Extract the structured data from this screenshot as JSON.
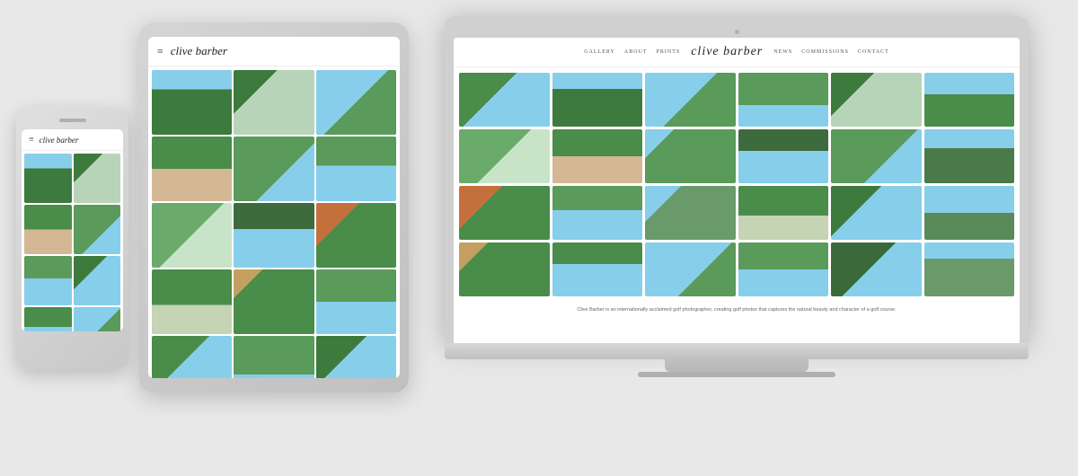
{
  "scene": {
    "background_color": "#e8e8e8"
  },
  "laptop": {
    "website": {
      "nav": {
        "logo": "clive barber",
        "left_links": [
          "GALLERY",
          "ABOUT",
          "PRINTS"
        ],
        "right_links": [
          "NEWS",
          "COMMISSIONS",
          "CONTACT"
        ]
      },
      "gallery": {
        "photo_count": 24,
        "photos": [
          {
            "id": 1,
            "class": "gp1"
          },
          {
            "id": 2,
            "class": "gp2"
          },
          {
            "id": 3,
            "class": "gp3"
          },
          {
            "id": 4,
            "class": "gp4"
          },
          {
            "id": 5,
            "class": "gp5"
          },
          {
            "id": 6,
            "class": "gp6"
          },
          {
            "id": 7,
            "class": "gp7"
          },
          {
            "id": 8,
            "class": "gp8"
          },
          {
            "id": 9,
            "class": "gp9"
          },
          {
            "id": 10,
            "class": "gp10"
          },
          {
            "id": 11,
            "class": "gp11"
          },
          {
            "id": 12,
            "class": "gp12"
          },
          {
            "id": 13,
            "class": "gp13"
          },
          {
            "id": 14,
            "class": "gp14"
          },
          {
            "id": 15,
            "class": "gp15"
          },
          {
            "id": 16,
            "class": "gp16"
          },
          {
            "id": 17,
            "class": "gp17"
          },
          {
            "id": 18,
            "class": "gp18"
          },
          {
            "id": 19,
            "class": "gp19"
          },
          {
            "id": 20,
            "class": "gp20"
          },
          {
            "id": 21,
            "class": "gp21"
          },
          {
            "id": 22,
            "class": "gp22"
          },
          {
            "id": 23,
            "class": "gp23"
          },
          {
            "id": 24,
            "class": "gp24"
          }
        ]
      },
      "footer_text": "Clive Barber is an internationally acclaimed golf photographer, creating golf photos that captures the natural beauty and character of a golf course."
    }
  },
  "tablet": {
    "nav": {
      "logo": "clive barber",
      "hamburger": "≡"
    }
  },
  "phone": {
    "nav": {
      "logo": "clive barber",
      "hamburger": "≡"
    }
  }
}
